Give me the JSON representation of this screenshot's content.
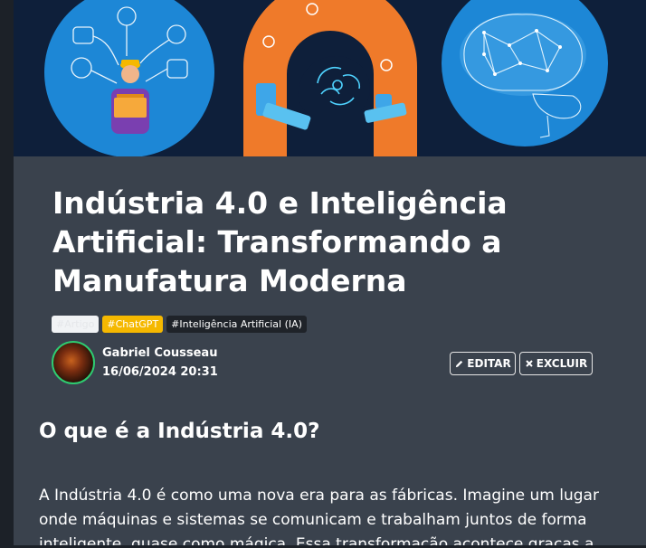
{
  "hero": {
    "colors": {
      "circle_blue": "#1d87d6",
      "circle_orange": "#ef7a2a",
      "background": "#0e1f3a"
    },
    "icons": [
      "worker-icon",
      "robot-arm-icon",
      "brain-head-icon",
      "glowing-brain-icon"
    ]
  },
  "article": {
    "title": "Indústria 4.0 e Inteligência Artificial: Transformando a Manufatura Moderna",
    "tags": [
      "#Artigo",
      "#ChatGPT",
      "#Inteligência Artificial (IA)"
    ],
    "author": "Gabriel Cousseau",
    "date": "16/06/2024 20:31",
    "edit_label": "EDITAR",
    "delete_label": "EXCLUIR",
    "section_heading": "O que é a Indústria 4.0?",
    "body": "A Indústria 4.0 é como uma nova era para as fábricas. Imagine um lugar onde máquinas e sistemas se comunicam e trabalham juntos de forma inteligente, quase como mágica. Essa transformação acontece graças a"
  },
  "colors": {
    "accent_green": "#2ecc71",
    "tag_yellow": "#f5b800",
    "card_bg": "#3a424d"
  }
}
